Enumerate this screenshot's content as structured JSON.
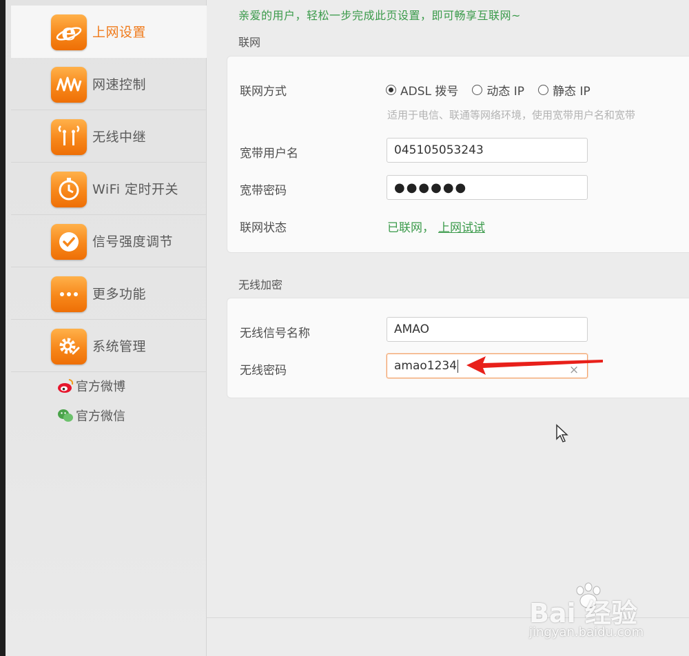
{
  "greeting": "亲爱的用户，轻松一步完成此页设置，即可畅享互联网~",
  "sidebar": {
    "items": [
      {
        "label": "上网设置",
        "icon": "ie-e-icon",
        "active": true
      },
      {
        "label": "网速控制",
        "icon": "speed-wave-icon",
        "active": false
      },
      {
        "label": "无线中继",
        "icon": "wireless-relay-icon",
        "active": false
      },
      {
        "label": "WiFi 定时开关",
        "icon": "timer-icon",
        "active": false
      },
      {
        "label": "信号强度调节",
        "icon": "signal-check-icon",
        "active": false
      },
      {
        "label": "更多功能",
        "icon": "more-dots-icon",
        "active": false
      },
      {
        "label": "系统管理",
        "icon": "gear-icon",
        "active": false
      }
    ],
    "social": [
      {
        "label": "官方微博",
        "icon": "weibo-icon"
      },
      {
        "label": "官方微信",
        "icon": "wechat-icon"
      }
    ]
  },
  "internet": {
    "section_title": "联网",
    "mode_label": "联网方式",
    "modes": [
      {
        "label": "ADSL 拨号",
        "checked": true
      },
      {
        "label": "动态 IP",
        "checked": false
      },
      {
        "label": "静态 IP",
        "checked": false
      }
    ],
    "hint": "适用于电信、联通等网络环境，使用宽带用户名和宽带",
    "username_label": "宽带用户名",
    "username_value": "045105053243",
    "password_label": "宽带密码",
    "password_value": "●●●●●●",
    "status_label": "联网状态",
    "status_text": "已联网，",
    "status_link": "上网试试"
  },
  "wireless": {
    "section_title": "无线加密",
    "ssid_label": "无线信号名称",
    "ssid_value": "AMAO",
    "password_label": "无线密码",
    "password_value": "amao1234",
    "clear_icon": "×"
  },
  "watermark": {
    "main": "Bai 经验",
    "sub": "jingyan.baidu.com"
  },
  "colors": {
    "accent_orange": "#f07a1a",
    "status_green": "#3a9a4a",
    "arrow_red": "#e8201a"
  }
}
